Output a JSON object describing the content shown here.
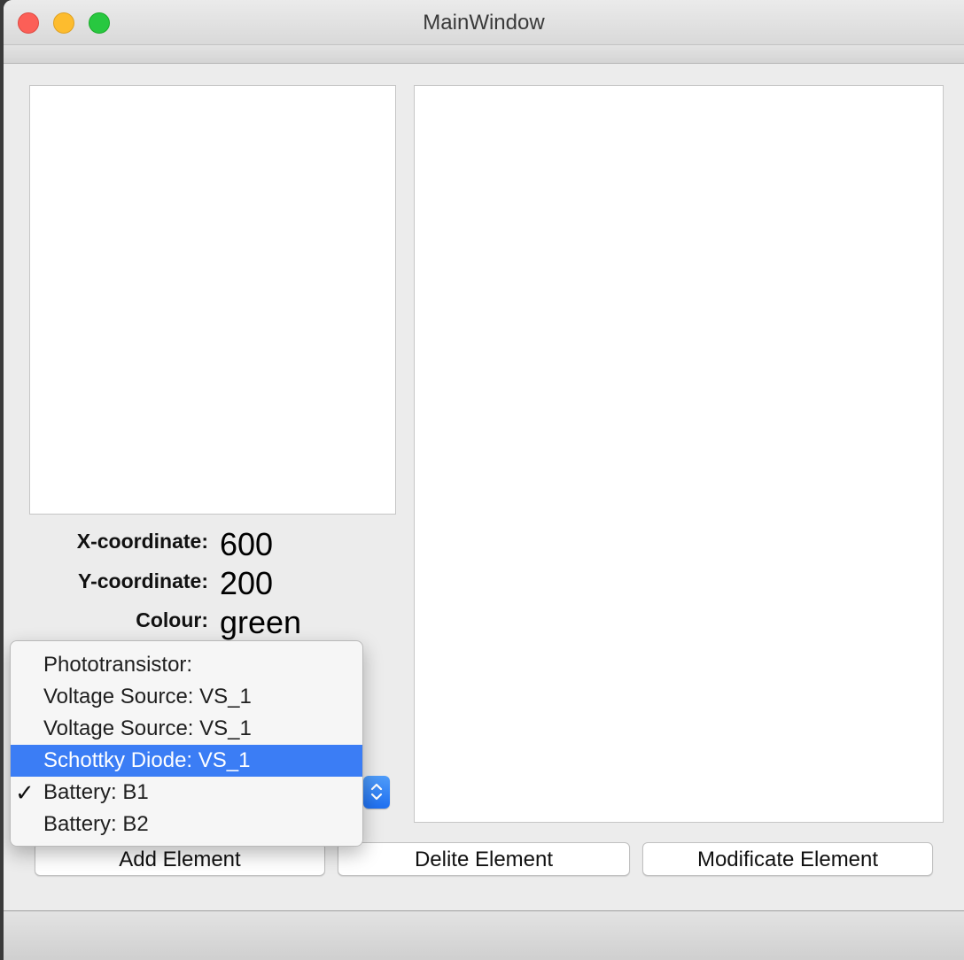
{
  "window": {
    "title": "MainWindow"
  },
  "traffic_lights": {
    "close": "close-button",
    "minimize": "minimize-button",
    "zoom": "zoom-button"
  },
  "info": {
    "x_label": "X-coordinate:",
    "x_value": "600",
    "y_label": "Y-coordinate:",
    "y_value": "200",
    "colour_label": "Colour:",
    "colour_value": "green"
  },
  "dropdown": {
    "selected_value": "Battery: B1",
    "highlighted_value": "Schottky Diode: VS_1",
    "options": [
      "Phototransistor:",
      "Voltage Source: VS_1",
      "Voltage Source: VS_1",
      "Schottky Diode: VS_1",
      "Battery: B1",
      "Battery: B2"
    ],
    "check_glyph": "✓"
  },
  "buttons": {
    "add": "Add Element",
    "delete": "Delite Element",
    "modify": "Modificate Element"
  },
  "colors": {
    "accent": "#3b7df5",
    "close": "#fc5f57",
    "minimize": "#fdbc2e",
    "zoom": "#28c840"
  }
}
